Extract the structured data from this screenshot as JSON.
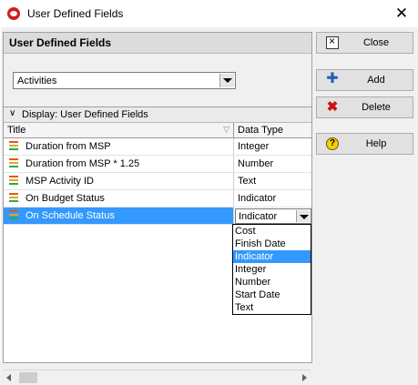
{
  "window": {
    "title": "User Defined Fields",
    "close_glyph": "✕"
  },
  "header": {
    "title": "User Defined Fields",
    "subject_area": "Activities"
  },
  "display": {
    "label": "Display: User Defined Fields",
    "columns": {
      "title": "Title",
      "data_type": "Data Type"
    },
    "rows": [
      {
        "title": "Duration from MSP",
        "data_type": "Integer"
      },
      {
        "title": "Duration from MSP * 1.25",
        "data_type": "Number"
      },
      {
        "title": "MSP Activity ID",
        "data_type": "Text"
      },
      {
        "title": "On Budget Status",
        "data_type": "Indicator"
      },
      {
        "title": "On Schedule Status",
        "data_type": "Indicator",
        "selected": true
      }
    ]
  },
  "data_type_dropdown": {
    "selected": "Indicator",
    "options": [
      "Cost",
      "Finish Date",
      "Indicator",
      "Integer",
      "Number",
      "Start Date",
      "Text"
    ]
  },
  "buttons": {
    "close": {
      "label": "Close",
      "icon": "close-window-icon"
    },
    "add": {
      "label": "Add",
      "icon": "plus-icon"
    },
    "delete": {
      "label": "Delete",
      "icon": "red-x-icon"
    },
    "help": {
      "label": "Help",
      "icon": "help-question-icon"
    }
  },
  "colors": {
    "selection": "#3399ff",
    "app_icon": "#d21f1f"
  }
}
